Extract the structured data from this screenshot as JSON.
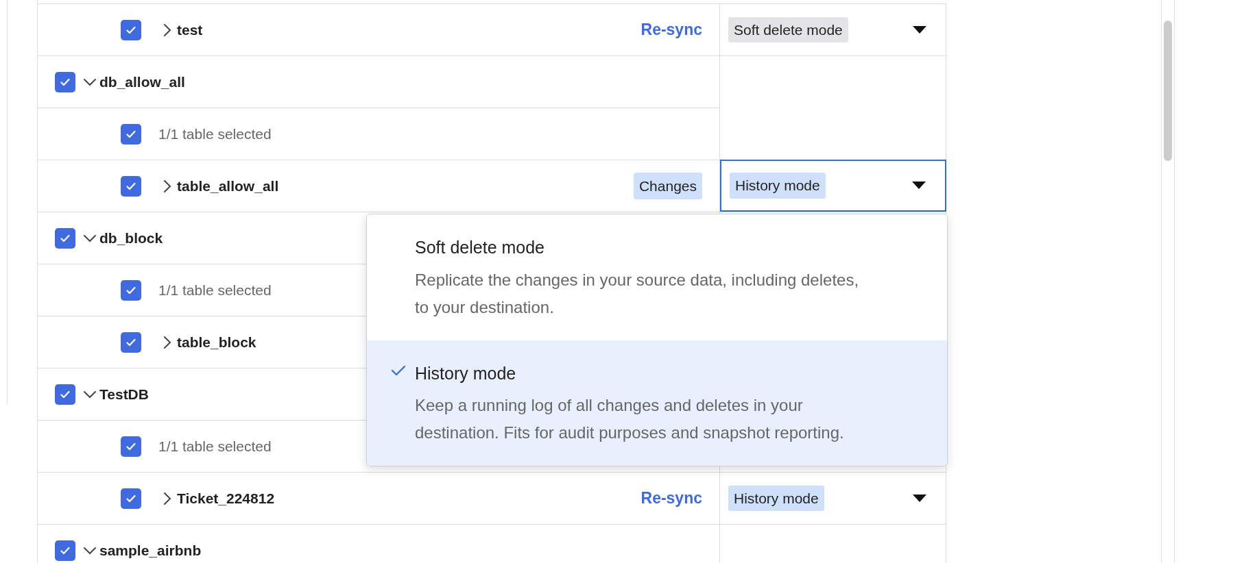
{
  "rows": [
    {
      "kind": "table",
      "label": "test",
      "checked": true,
      "expanded": false,
      "action": {
        "kind": "link",
        "label": "Re-sync"
      },
      "mode": {
        "label": "Soft delete mode",
        "color": "#e4e4e7",
        "focused": false
      }
    },
    {
      "kind": "database",
      "label": "db_allow_all",
      "checked": true,
      "expanded": true
    },
    {
      "kind": "summary",
      "label": "1/1 table selected",
      "checked": true
    },
    {
      "kind": "table",
      "label": "table_allow_all",
      "checked": true,
      "expanded": false,
      "action": {
        "kind": "badge",
        "label": "Changes"
      },
      "mode": {
        "label": "History mode",
        "color": "#cfe0fb",
        "focused": true
      }
    },
    {
      "kind": "database",
      "label": "db_block",
      "checked": true,
      "expanded": true
    },
    {
      "kind": "summary",
      "label": "1/1 table selected",
      "checked": true
    },
    {
      "kind": "table",
      "label": "table_block",
      "checked": true,
      "expanded": false
    },
    {
      "kind": "database",
      "label": "TestDB",
      "checked": true,
      "expanded": true
    },
    {
      "kind": "summary",
      "label": "1/1 table selected",
      "checked": true
    },
    {
      "kind": "table",
      "label": "Ticket_224812",
      "checked": true,
      "expanded": false,
      "action": {
        "kind": "link",
        "label": "Re-sync"
      },
      "mode": {
        "label": "History mode",
        "color": "#cfe0fb",
        "focused": false
      }
    },
    {
      "kind": "database",
      "label": "sample_airbnb",
      "checked": true,
      "expanded": true
    }
  ],
  "dropdown": {
    "options": [
      {
        "title": "Soft delete mode",
        "description": "Replicate the changes in your source data, including deletes, to your destination.",
        "selected": false
      },
      {
        "title": "History mode",
        "description": "Keep a running log of all changes and deletes in your destination. Fits for audit purposes and snapshot reporting.",
        "selected": true
      }
    ]
  }
}
